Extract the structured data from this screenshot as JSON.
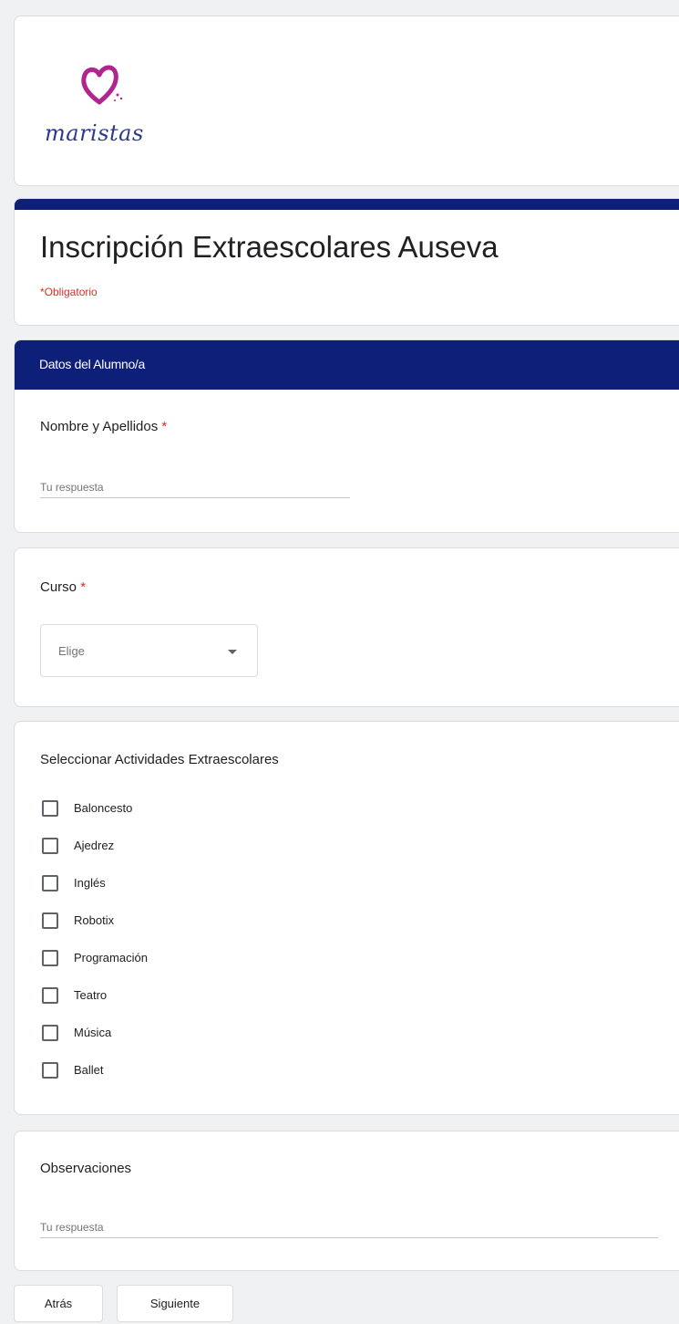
{
  "logo": {
    "text": "maristas",
    "accent_color": "#b0258f",
    "text_color": "#2d3a8c"
  },
  "form": {
    "title": "Inscripción Extraescolares Auseva",
    "required_note": "*Obligatorio"
  },
  "section": {
    "header": "Datos del Alumno/a",
    "header_color": "#0d1f78"
  },
  "questions": {
    "nombre": {
      "label": "Nombre y Apellidos",
      "required": "*",
      "placeholder": "Tu respuesta"
    },
    "curso": {
      "label": "Curso",
      "required": "*",
      "selected": "Elige"
    },
    "actividades": {
      "label": "Seleccionar Actividades Extraescolares",
      "options": [
        "Baloncesto",
        "Ajedrez",
        "Inglés",
        "Robotix",
        "Programación",
        "Teatro",
        "Música",
        "Ballet"
      ]
    },
    "observaciones": {
      "label": "Observaciones",
      "placeholder": "Tu respuesta"
    }
  },
  "nav": {
    "back": "Atrás",
    "next": "Siguiente"
  }
}
